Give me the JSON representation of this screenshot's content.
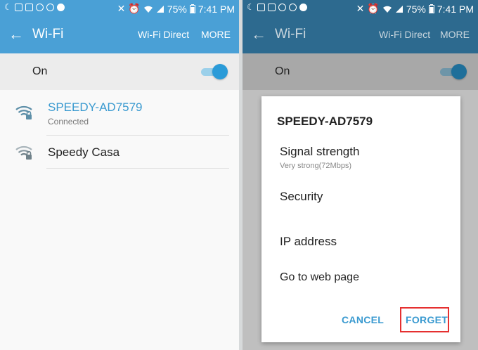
{
  "status_bar": {
    "battery": "75%",
    "time": "7:41 PM"
  },
  "left_screen": {
    "appbar": {
      "back_icon": "arrow-left-icon",
      "title": "Wi-Fi",
      "wifi_direct_label": "Wi-Fi Direct",
      "more_label": "MORE"
    },
    "toggle_row": {
      "label": "On",
      "state": "on"
    },
    "networks": [
      {
        "name": "SPEEDY-AD7579",
        "status": "Connected",
        "color": "#3a9ad0",
        "icon": "wifi-lock-icon"
      },
      {
        "name": "Speedy Casa",
        "status": "",
        "color": "#222222",
        "icon": "wifi-lock-icon"
      }
    ]
  },
  "right_screen": {
    "appbar": {
      "title": "Wi-Fi",
      "wifi_direct_label": "Wi-Fi Direct",
      "more_label": "MORE"
    },
    "toggle_row": {
      "label": "On"
    },
    "dialog": {
      "title": "SPEEDY-AD7579",
      "items": [
        {
          "label": "Signal strength",
          "detail": "Very strong(72Mbps)"
        },
        {
          "label": "Security",
          "detail": ""
        },
        {
          "label": "IP address",
          "detail": ""
        },
        {
          "label": "Go to web page",
          "detail": ""
        }
      ],
      "cancel_label": "CANCEL",
      "forget_label": "FORGET",
      "highlight_color": "#e53030"
    }
  },
  "colors": {
    "appbar_left": "#4aa0d6",
    "appbar_right_dimmed": "#2d6a8f",
    "accent": "#2a9bd8"
  }
}
